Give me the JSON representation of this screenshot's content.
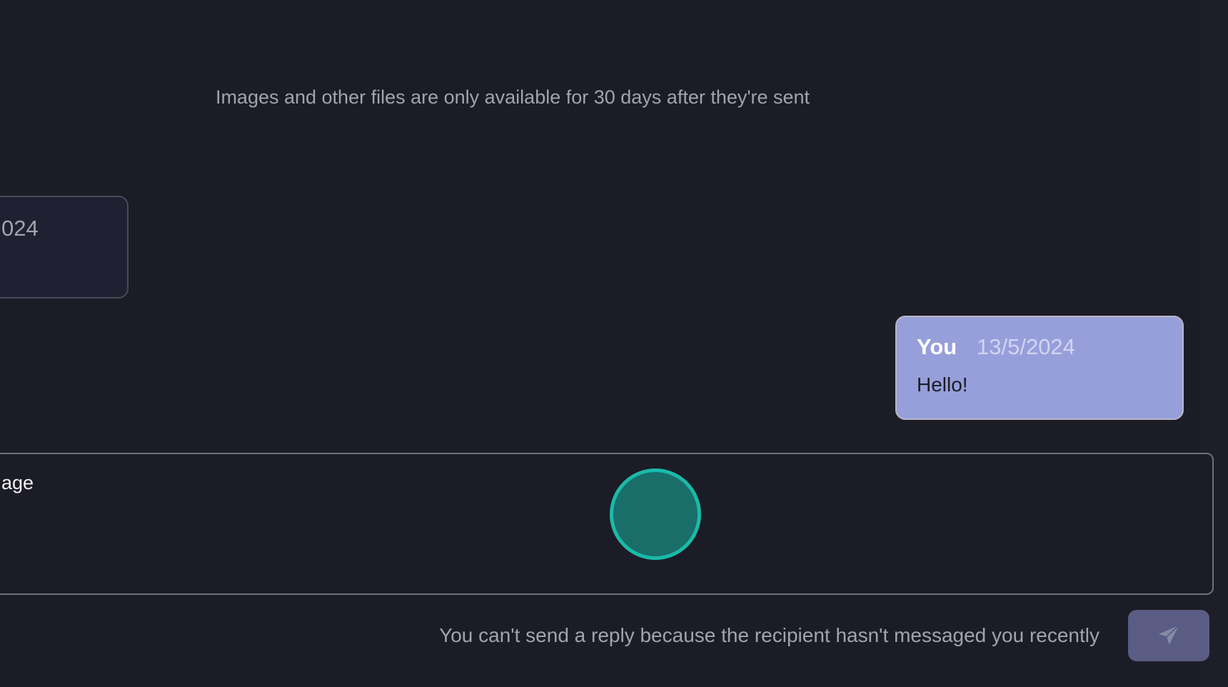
{
  "conversation": {
    "file_notice": "Images and other files are only available for 30 days after they're sent",
    "received_message": {
      "date_fragment": "024"
    },
    "sent_message": {
      "author": "You",
      "date": "13/5/2024",
      "text": "Hello!"
    }
  },
  "composer": {
    "text_fragment": "age",
    "blocked_notice": "You can't send a reply because the recipient hasn't messaged you recently",
    "send_icon": "paper-plane-icon"
  },
  "colors": {
    "background": "#1c1c26",
    "sent_bubble": "#979fdb",
    "send_button": "#5a5c83",
    "pointer": "#1bbaa8"
  }
}
